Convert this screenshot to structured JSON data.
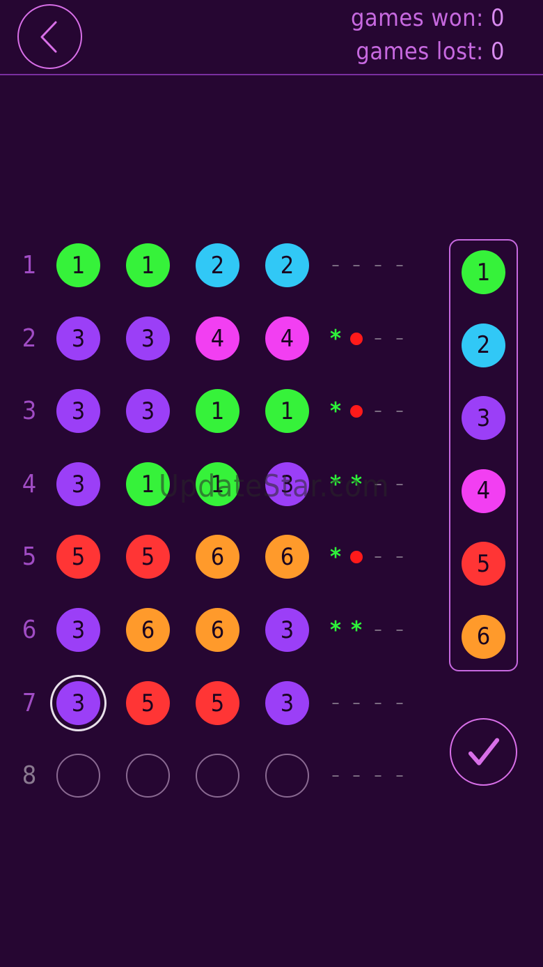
{
  "header": {
    "games_won_label": "games won:",
    "games_won_value": "0",
    "games_lost_label": "games lost:",
    "games_lost_value": "0"
  },
  "colors": {
    "1": "#36f23a",
    "2": "#31c8f6",
    "3": "#9b3ff7",
    "4": "#f23ff2",
    "5": "#ff3535",
    "6": "#ff9a2b"
  },
  "board": [
    {
      "label": "1",
      "pegs": [
        "1",
        "1",
        "2",
        "2"
      ],
      "feedback": [
        "dash",
        "dash",
        "dash",
        "dash"
      ]
    },
    {
      "label": "2",
      "pegs": [
        "3",
        "3",
        "4",
        "4"
      ],
      "feedback": [
        "star",
        "dot",
        "dash",
        "dash"
      ]
    },
    {
      "label": "3",
      "pegs": [
        "3",
        "3",
        "1",
        "1"
      ],
      "feedback": [
        "star",
        "dot",
        "dash",
        "dash"
      ]
    },
    {
      "label": "4",
      "pegs": [
        "3",
        "1",
        "1",
        "3"
      ],
      "feedback": [
        "star",
        "star",
        "dash",
        "dash"
      ]
    },
    {
      "label": "5",
      "pegs": [
        "5",
        "5",
        "6",
        "6"
      ],
      "feedback": [
        "star",
        "dot",
        "dash",
        "dash"
      ]
    },
    {
      "label": "6",
      "pegs": [
        "3",
        "6",
        "6",
        "3"
      ],
      "feedback": [
        "star",
        "star",
        "dash",
        "dash"
      ]
    },
    {
      "label": "7",
      "pegs": [
        "3",
        "5",
        "5",
        "3"
      ],
      "feedback": [
        "dash",
        "dash",
        "dash",
        "dash"
      ]
    },
    {
      "label": "8",
      "pegs": [
        "",
        "",
        "",
        ""
      ],
      "feedback": [
        "dash",
        "dash",
        "dash",
        "dash"
      ]
    }
  ],
  "selected_peg": {
    "row": 7,
    "col": 1
  },
  "palette": [
    "1",
    "2",
    "3",
    "4",
    "5",
    "6"
  ],
  "watermark": "UpdateStar.com"
}
